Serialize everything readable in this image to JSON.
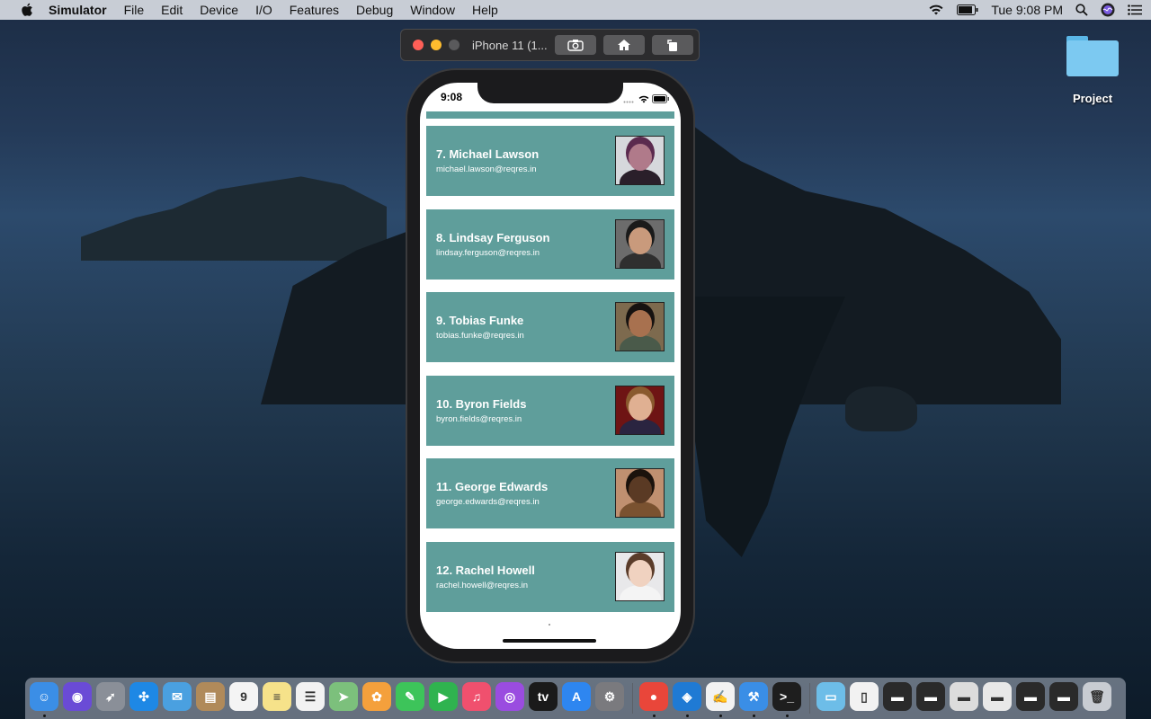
{
  "menubar": {
    "app_name": "Simulator",
    "items": [
      "File",
      "Edit",
      "Device",
      "I/O",
      "Features",
      "Debug",
      "Window",
      "Help"
    ],
    "clock": "Tue 9:08 PM"
  },
  "simulator": {
    "title": "iPhone 11 (1...",
    "buttons": [
      "screenshot-icon",
      "home-icon",
      "rotate-icon"
    ]
  },
  "phone": {
    "status_time": "9:08",
    "users": [
      {
        "name": "7. Michael Lawson",
        "email": "michael.lawson@reqres.in",
        "avatar_bg": "#d6d8dc",
        "hair": "#5b2a4e",
        "skin": "#b07a8a",
        "body": "#2a1f2a"
      },
      {
        "name": "8. Lindsay Ferguson",
        "email": "lindsay.ferguson@reqres.in",
        "avatar_bg": "#6c6c6c",
        "hair": "#1a1a1a",
        "skin": "#c99a7c",
        "body": "#2f2f2f"
      },
      {
        "name": "9. Tobias Funke",
        "email": "tobias.funke@reqres.in",
        "avatar_bg": "#7d6a4e",
        "hair": "#161210",
        "skin": "#a8714f",
        "body": "#4a5a4a"
      },
      {
        "name": "10. Byron Fields",
        "email": "byron.fields@reqres.in",
        "avatar_bg": "#6e1414",
        "hair": "#8a5a2e",
        "skin": "#e0b092",
        "body": "#2a2440"
      },
      {
        "name": "11. George Edwards",
        "email": "george.edwards@reqres.in",
        "avatar_bg": "#c09070",
        "hair": "#1a120c",
        "skin": "#5a3a24",
        "body": "#7a5230"
      },
      {
        "name": "12. Rachel Howell",
        "email": "rachel.howell@reqres.in",
        "avatar_bg": "#e8e8ea",
        "hair": "#5a3c2a",
        "skin": "#f0d2c0",
        "body": "#f4f4f4"
      }
    ]
  },
  "desktop": {
    "folder_label": "Project"
  },
  "dock": {
    "apps": [
      {
        "name": "finder-icon",
        "color": "#3b8ee6",
        "glyph": "☺",
        "running": true
      },
      {
        "name": "siri-icon",
        "color": "#6a4bd6",
        "glyph": "◉",
        "running": false
      },
      {
        "name": "launchpad-icon",
        "color": "#8a8f98",
        "glyph": "➶",
        "running": false
      },
      {
        "name": "safari-icon",
        "color": "#1e88e5",
        "glyph": "✣",
        "running": false
      },
      {
        "name": "mail-icon",
        "color": "#4aa0e0",
        "glyph": "✉",
        "running": false
      },
      {
        "name": "contacts-icon",
        "color": "#b08a5a",
        "glyph": "▤",
        "running": false
      },
      {
        "name": "calendar-icon",
        "color": "#f4f4f4",
        "glyph": "9",
        "running": false
      },
      {
        "name": "notes-icon",
        "color": "#f6e28a",
        "glyph": "≡",
        "running": false
      },
      {
        "name": "reminders-icon",
        "color": "#f2f2f2",
        "glyph": "☰",
        "running": false
      },
      {
        "name": "maps-icon",
        "color": "#7cc07c",
        "glyph": "➤",
        "running": false
      },
      {
        "name": "photos-icon",
        "color": "#f4a03c",
        "glyph": "✿",
        "running": false
      },
      {
        "name": "messages-icon",
        "color": "#3dc45a",
        "glyph": "✎",
        "running": false
      },
      {
        "name": "facetime-icon",
        "color": "#2fb34f",
        "glyph": "▶",
        "running": false
      },
      {
        "name": "music-icon",
        "color": "#f0506e",
        "glyph": "♫",
        "running": false
      },
      {
        "name": "podcasts-icon",
        "color": "#9a4ce0",
        "glyph": "◎",
        "running": false
      },
      {
        "name": "tv-icon",
        "color": "#1a1a1a",
        "glyph": "tv",
        "running": false
      },
      {
        "name": "app-store-icon",
        "color": "#2e86f0",
        "glyph": "A",
        "running": false
      },
      {
        "name": "system-preferences-icon",
        "color": "#7a7a7e",
        "glyph": "⚙",
        "running": false
      },
      {
        "name": "chrome-icon",
        "color": "#e9463a",
        "glyph": "●",
        "running": true
      },
      {
        "name": "vscode-icon",
        "color": "#1f7ad4",
        "glyph": "◈",
        "running": true
      },
      {
        "name": "textedit-icon",
        "color": "#f2f2f2",
        "glyph": "✍",
        "running": true
      },
      {
        "name": "xcode-icon",
        "color": "#3a8ee6",
        "glyph": "⚒",
        "running": true
      },
      {
        "name": "terminal-icon",
        "color": "#1e1e1e",
        "glyph": ">_",
        "running": true
      },
      {
        "name": "folder-icon",
        "color": "#6dbde8",
        "glyph": "▭",
        "running": false
      },
      {
        "name": "document-icon",
        "color": "#f2f2f2",
        "glyph": "▯",
        "running": false
      },
      {
        "name": "window-thumb-1-icon",
        "color": "#2a2a2a",
        "glyph": "▬",
        "running": false
      },
      {
        "name": "window-thumb-2-icon",
        "color": "#2a2a2a",
        "glyph": "▬",
        "running": false
      },
      {
        "name": "window-thumb-3-icon",
        "color": "#dcdcdc",
        "glyph": "▬",
        "running": false
      },
      {
        "name": "window-thumb-4-icon",
        "color": "#e8e8e8",
        "glyph": "▬",
        "running": false
      },
      {
        "name": "window-thumb-5-icon",
        "color": "#2a2a2a",
        "glyph": "▬",
        "running": false
      },
      {
        "name": "window-thumb-6-icon",
        "color": "#2a2a2a",
        "glyph": "▬",
        "running": false
      },
      {
        "name": "trash-icon",
        "color": "#c8ccd2",
        "glyph": "🗑",
        "running": false
      }
    ]
  },
  "colors": {
    "card": "#5f9e9b",
    "menubar": "#e4e8ee"
  }
}
